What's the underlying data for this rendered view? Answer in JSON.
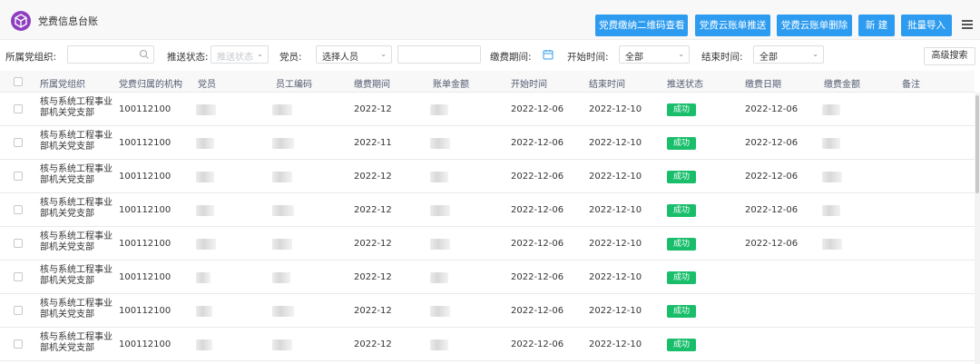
{
  "app": {
    "title": "党费信息台账"
  },
  "toolbar": {
    "btn_qrcode": "党费缴纳二维码查看",
    "btn_push": "党费云账单推送",
    "btn_delete": "党费云账单删除",
    "btn_new": "新 建",
    "btn_import": "批量导入",
    "list_icon": "list-icon"
  },
  "filters": {
    "org_label": "所属党组织:",
    "push_status_label": "推送状态:",
    "push_status_placeholder": "推送状态",
    "member_label": "党员:",
    "member_value": "选择人员",
    "period_label": "缴费期间:",
    "start_label": "开始时间:",
    "start_value": "全部",
    "end_label": "结束时间:",
    "end_value": "全部",
    "advanced_search": "高级搜索"
  },
  "table": {
    "columns": [
      "所属党组织",
      "党费归属的机构",
      "党员",
      "员工编码",
      "缴费期间",
      "账单金额",
      "开始时间",
      "结束时间",
      "推送状态",
      "缴费日期",
      "缴费金额",
      "备注"
    ],
    "rows": [
      {
        "org": "核与系统工程事业部机关党支部",
        "inst": "100112100",
        "period": "2022-12",
        "start": "2022-12-06",
        "end": "2022-12-10",
        "status": "成功",
        "pay_date": "2022-12-06"
      },
      {
        "org": "核与系统工程事业部机关党支部",
        "inst": "100112100",
        "period": "2022-11",
        "start": "2022-12-06",
        "end": "2022-12-10",
        "status": "成功",
        "pay_date": "2022-12-06"
      },
      {
        "org": "核与系统工程事业部机关党支部",
        "inst": "100112100",
        "period": "2022-12",
        "start": "2022-12-06",
        "end": "2022-12-10",
        "status": "成功",
        "pay_date": "2022-12-06"
      },
      {
        "org": "核与系统工程事业部机关党支部",
        "inst": "100112100",
        "period": "2022-12",
        "start": "2022-12-06",
        "end": "2022-12-10",
        "status": "成功",
        "pay_date": "2022-12-06"
      },
      {
        "org": "核与系统工程事业部机关党支部",
        "inst": "100112100",
        "period": "2022-12",
        "start": "2022-12-06",
        "end": "2022-12-10",
        "status": "成功",
        "pay_date": "2022-12-06"
      },
      {
        "org": "核与系统工程事业部机关党支部",
        "inst": "100112100",
        "period": "2022-12",
        "start": "2022-12-06",
        "end": "2022-12-10",
        "status": "成功",
        "pay_date": ""
      },
      {
        "org": "核与系统工程事业部机关党支部",
        "inst": "100112100",
        "period": "2022-12",
        "start": "2022-12-06",
        "end": "2022-12-10",
        "status": "成功",
        "pay_date": ""
      },
      {
        "org": "核与系统工程事业部机关党支部",
        "inst": "100112100",
        "period": "2022-12",
        "start": "2022-12-06",
        "end": "2022-12-10",
        "status": "成功",
        "pay_date": ""
      }
    ]
  },
  "colors": {
    "accent": "#2d9cf0",
    "success": "#19be6b",
    "logo": "#8e3fbf"
  }
}
